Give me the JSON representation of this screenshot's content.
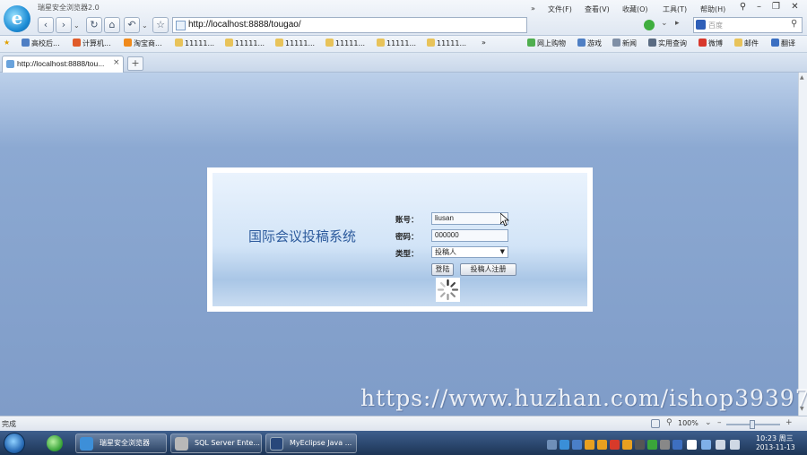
{
  "browser": {
    "app_title": "瑞星安全浏览器2.0",
    "address": "http://localhost:8888/tougao/",
    "search_placeholder": "百度",
    "menu": {
      "file": "文件(F)",
      "view": "查看(V)",
      "favorites": "收藏(O)",
      "tools": "工具(T)",
      "help": "帮助(H)",
      "more": "»"
    },
    "nav": {
      "back": "‹",
      "forward": "›",
      "refresh": "↻",
      "home": "⌂",
      "undo": "↶",
      "star": "☆"
    }
  },
  "favorites": {
    "star": "★",
    "items": [
      "高校后...",
      "计算机...",
      "淘宝商...",
      "11111...",
      "11111...",
      "11111...",
      "11111...",
      "11111...",
      "11111..."
    ],
    "more": "»",
    "right_items": [
      "网上购物",
      "游戏",
      "新闻",
      "实用查询",
      "微博",
      "邮件",
      "翻译"
    ]
  },
  "tab": {
    "label": "http://localhost:8888/tou...",
    "close": "×",
    "new_tab": "+"
  },
  "login": {
    "system_title": "国际会议投稿系统",
    "account_label": "账号：",
    "account_value": "liusan",
    "password_label": "密码：",
    "password_value": "000000",
    "type_label": "类型：",
    "type_value": "投稿人",
    "login_button": "登陆",
    "register_button": "投稿人注册"
  },
  "watermark": "https://www.huzhan.com/ishop39397",
  "status": {
    "text": "完成",
    "zoom": "100%"
  },
  "taskbar": {
    "apps": [
      "瑞星安全浏览器",
      "SQL Server Ente...",
      "MyEclipse Java ..."
    ],
    "time": "10:23 周三",
    "date": "2013-11-13"
  },
  "colors": {
    "content_bg": "#7f9cc8",
    "title_text": "#2c5a9c",
    "taskbar": "#1d3556"
  }
}
